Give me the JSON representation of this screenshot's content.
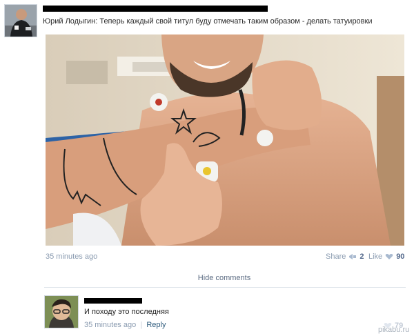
{
  "post": {
    "text": "Юрий Лодыгин: Теперь каждый свой титул буду отмечать таким образом - делать татуировки",
    "timestamp": "35 minutes ago",
    "share_label": "Share",
    "share_count": "2",
    "like_label": "Like",
    "like_count": "90"
  },
  "comments": {
    "hide_label": "Hide comments",
    "items": [
      {
        "text": "И походу это последняя",
        "timestamp": "35 minutes ago",
        "reply_label": "Reply",
        "like_count": "79"
      }
    ]
  },
  "watermark": "pikabu.ru",
  "colors": {
    "link": "#2b587a",
    "meta": "#8a9bb0",
    "censor": "#000000"
  }
}
